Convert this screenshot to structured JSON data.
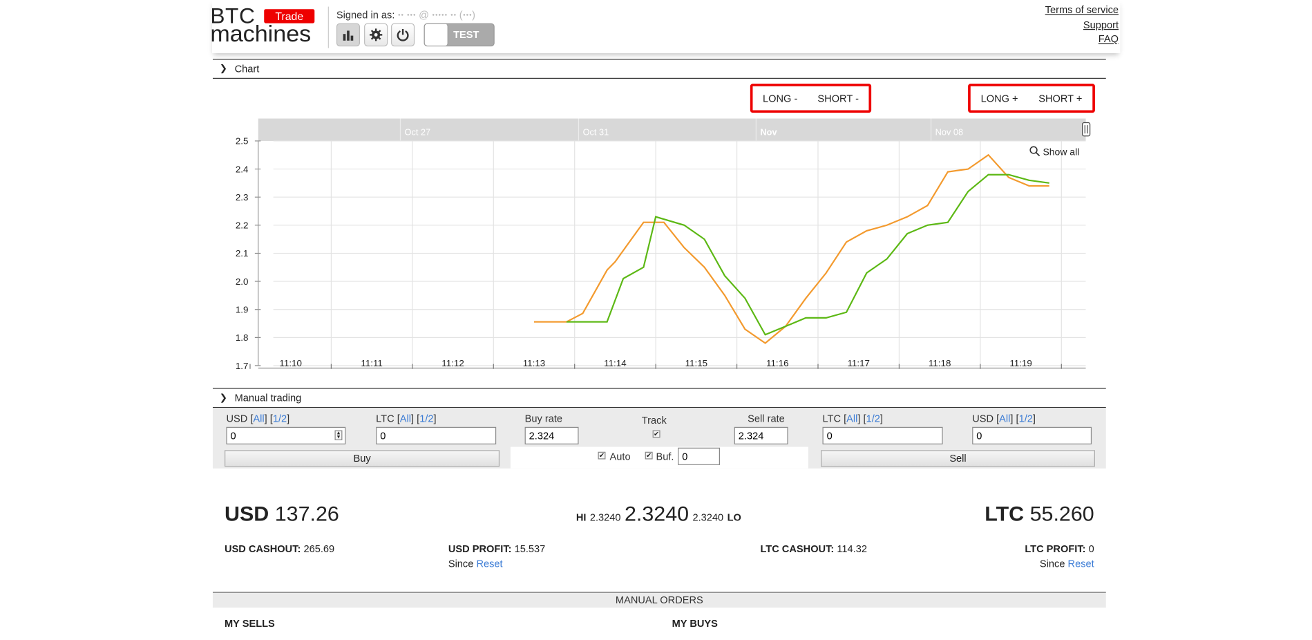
{
  "header": {
    "logo_line1": "BTC",
    "logo_line2": "machines",
    "trade_badge": "Trade",
    "signed_in_label": "Signed in as: ",
    "signed_in_user": "ꞏꞏ ꞏꞏꞏ @ ꞏꞏꞏꞏꞏ ꞏꞏ (ꞏꞏꞏ)",
    "toggle_label": "TEST",
    "links": [
      "Terms of service",
      "Support",
      "FAQ"
    ]
  },
  "chart_section": {
    "title": "Chart",
    "left_group": [
      "LONG -",
      "SHORT -"
    ],
    "right_group": [
      "LONG +",
      "SHORT +"
    ],
    "show_all": "Show all"
  },
  "chart_data": {
    "type": "line",
    "navigator_labels": [
      "Oct 27",
      "Oct 31",
      "Nov",
      "Nov 08"
    ],
    "x_ticks": [
      "11:10",
      "11:11",
      "11:12",
      "11:13",
      "11:14",
      "11:15",
      "11:16",
      "11:17",
      "11:18",
      "11:19"
    ],
    "y_ticks": [
      "2.5",
      "2.4",
      "2.3",
      "2.2",
      "2.1",
      "2.0",
      "1.9",
      "1.8",
      "1.7"
    ],
    "ylim": [
      1.7,
      2.5
    ],
    "series": [
      {
        "color": "#f39a2e",
        "points": [
          [
            13.0,
            1.856
          ],
          [
            13.25,
            1.856
          ],
          [
            13.4,
            1.856
          ],
          [
            13.6,
            1.886
          ],
          [
            13.9,
            2.04
          ],
          [
            14.0,
            2.07
          ],
          [
            14.15,
            2.13
          ],
          [
            14.35,
            2.21
          ],
          [
            14.6,
            2.21
          ],
          [
            14.85,
            2.12
          ],
          [
            15.1,
            2.05
          ],
          [
            15.35,
            1.95
          ],
          [
            15.6,
            1.83
          ],
          [
            15.85,
            1.78
          ],
          [
            16.1,
            1.84
          ],
          [
            16.35,
            1.94
          ],
          [
            16.6,
            2.03
          ],
          [
            16.85,
            2.14
          ],
          [
            17.1,
            2.18
          ],
          [
            17.35,
            2.2
          ],
          [
            17.6,
            2.23
          ],
          [
            17.85,
            2.27
          ],
          [
            18.1,
            2.39
          ],
          [
            18.35,
            2.4
          ],
          [
            18.6,
            2.45
          ],
          [
            18.85,
            2.37
          ],
          [
            19.1,
            2.34
          ],
          [
            19.35,
            2.34
          ]
        ]
      },
      {
        "color": "#5cb814",
        "points": [
          [
            13.4,
            1.856
          ],
          [
            13.9,
            1.856
          ],
          [
            14.1,
            2.01
          ],
          [
            14.35,
            2.05
          ],
          [
            14.5,
            2.23
          ],
          [
            14.85,
            2.2
          ],
          [
            15.1,
            2.15
          ],
          [
            15.35,
            2.02
          ],
          [
            15.6,
            1.94
          ],
          [
            15.85,
            1.81
          ],
          [
            16.1,
            1.84
          ],
          [
            16.35,
            1.87
          ],
          [
            16.6,
            1.87
          ],
          [
            16.85,
            1.89
          ],
          [
            17.1,
            2.03
          ],
          [
            17.35,
            2.08
          ],
          [
            17.6,
            2.17
          ],
          [
            17.85,
            2.2
          ],
          [
            18.1,
            2.21
          ],
          [
            18.35,
            2.32
          ],
          [
            18.6,
            2.38
          ],
          [
            18.85,
            2.38
          ],
          [
            19.1,
            2.36
          ],
          [
            19.35,
            2.35
          ]
        ]
      }
    ]
  },
  "manual_trading": {
    "title": "Manual trading",
    "usd_left": {
      "label": "USD",
      "all": "All",
      "half": "1/2",
      "value": "0"
    },
    "ltc_left": {
      "label": "LTC",
      "all": "All",
      "half": "1/2",
      "value": "0"
    },
    "buy_rate": {
      "label": "Buy rate",
      "value": "2.324"
    },
    "track_label": "Track",
    "sell_rate": {
      "label": "Sell rate",
      "value": "2.324"
    },
    "ltc_right": {
      "label": "LTC",
      "all": "All",
      "half": "1/2",
      "value": "0"
    },
    "usd_right": {
      "label": "USD",
      "all": "All",
      "half": "1/2",
      "value": "0"
    },
    "buy_button": "Buy",
    "sell_button": "Sell",
    "auto_label": "Auto",
    "buf_label": "Buf.",
    "buf_value": "0"
  },
  "balances": {
    "usd_label": "USD",
    "usd_value": "137.26",
    "ltc_label": "LTC",
    "ltc_value": "55.260",
    "hi_label": "HI",
    "hi_value": "2.3240",
    "last_price": "2.3240",
    "lo_value": "2.3240",
    "lo_label": "LO",
    "usd_cashout_label": "USD CASHOUT:",
    "usd_cashout_value": "265.69",
    "usd_profit_label": "USD PROFIT:",
    "usd_profit_value": "15.537",
    "ltc_cashout_label": "LTC CASHOUT:",
    "ltc_cashout_value": "114.32",
    "ltc_profit_label": "LTC PROFIT:",
    "ltc_profit_value": "0",
    "since_label": "Since",
    "reset_link": "Reset"
  },
  "orders": {
    "title": "MANUAL ORDERS",
    "my_sells": "MY SELLS",
    "my_buys": "MY BUYS"
  }
}
